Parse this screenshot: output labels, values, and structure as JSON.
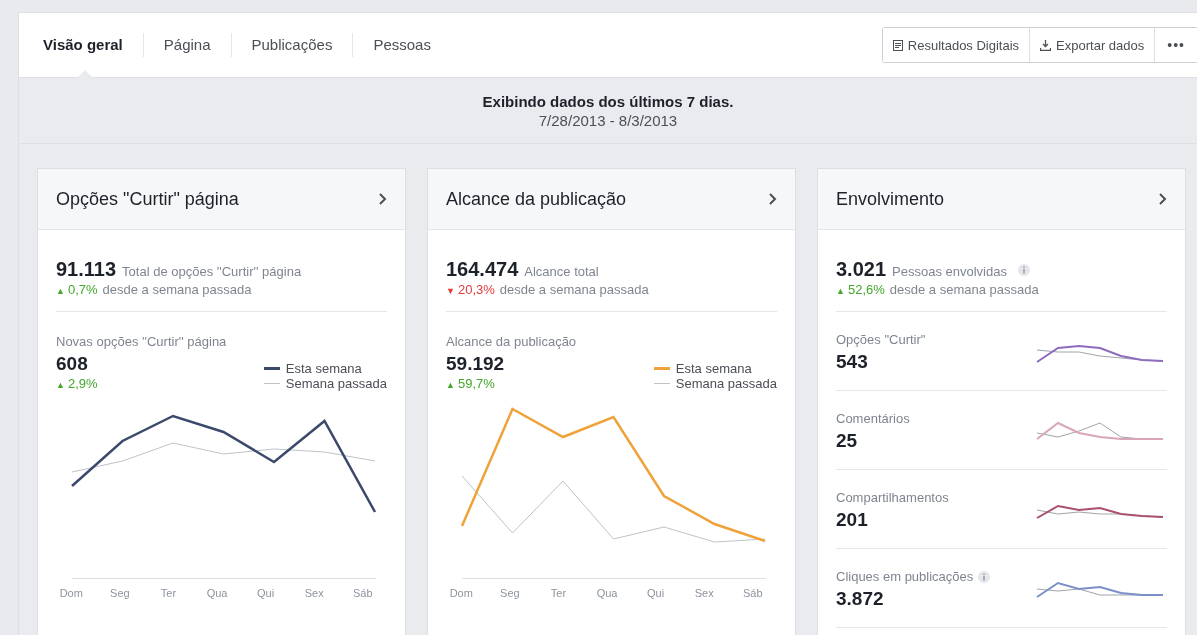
{
  "tabs": [
    {
      "label": "Visão geral",
      "selected": true
    },
    {
      "label": "Página",
      "selected": false
    },
    {
      "label": "Publicações",
      "selected": false
    },
    {
      "label": "Pessoas",
      "selected": false
    }
  ],
  "actions": [
    {
      "kind": "document",
      "label": "Resultados Digitais"
    },
    {
      "kind": "export",
      "label": "Exportar dados"
    },
    {
      "kind": "more",
      "label": "•••"
    }
  ],
  "period": {
    "title": "Exibindo dados dos últimos 7 dias.",
    "range": "7/28/2013 - 8/3/2013"
  },
  "cards": [
    {
      "kind": "line",
      "title": "Opções \"Curtir\" página",
      "total": "91.113",
      "total_label": "Total de opções ''Curtir'' página",
      "total_info": false,
      "change": "0,7%",
      "trend_icon": "▲",
      "rising": true,
      "change_label": "desde a semana passada",
      "chart_label": "Novas opções ''Curtir'' página",
      "chart_value": "608",
      "chart_change": "2,9%",
      "chart_trend_icon": "▲",
      "chart_rising": true,
      "color": "#3b4a6b",
      "legend": [
        "Esta semana",
        "Semana passada"
      ],
      "days": [
        "Dom",
        "Seg",
        "Ter",
        "Qua",
        "Qui",
        "Sex",
        "Sáb"
      ]
    },
    {
      "kind": "line",
      "title": "Alcance da publicação",
      "total": "164.474",
      "total_label": "Alcance total",
      "total_info": false,
      "change": "20,3%",
      "trend_icon": "▼",
      "rising": false,
      "change_label": "desde a semana passada",
      "chart_label": "Alcance da publicação",
      "chart_value": "59.192",
      "chart_change": "59,7%",
      "chart_trend_icon": "▲",
      "chart_rising": true,
      "color": "#f0a23a",
      "legend": [
        "Esta semana",
        "Semana passada"
      ],
      "days": [
        "Dom",
        "Seg",
        "Ter",
        "Qua",
        "Qui",
        "Sex",
        "Sáb"
      ]
    },
    {
      "kind": "list",
      "title": "Envolvimento",
      "total": "3.021",
      "total_label": "Pessoas envolvidas",
      "total_info": true,
      "change": "52,6%",
      "trend_icon": "▲",
      "rising": true,
      "change_label": "desde a semana passada",
      "rows": [
        {
          "label": "Opções \"Curtir\"",
          "value": "543",
          "info": false,
          "color": "#8e6bbf"
        },
        {
          "label": "Comentários",
          "value": "25",
          "info": false,
          "color": "#d9a5b8"
        },
        {
          "label": "Compartilhamentos",
          "value": "201",
          "info": false,
          "color": "#a8506e"
        },
        {
          "label": "Cliques em publicações",
          "value": "3.872",
          "info": true,
          "color": "#7b8fc9"
        }
      ]
    }
  ]
}
